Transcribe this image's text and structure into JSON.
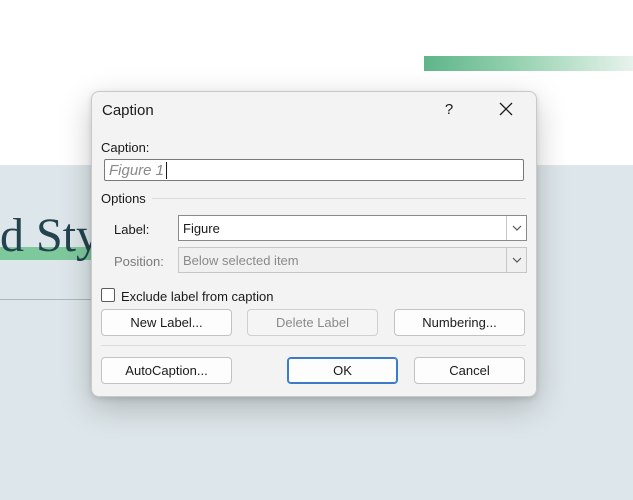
{
  "background": {
    "heading_text": "d Sty",
    "accent_color": "#5fb58a"
  },
  "dialog": {
    "title": "Caption",
    "help_glyph": "?",
    "close_glyph": "✕",
    "caption": {
      "label": "Caption:",
      "value": "Figure 1"
    },
    "options_label": "Options",
    "label_field": {
      "label": "Label:",
      "value": "Figure"
    },
    "position_field": {
      "label": "Position:",
      "value": "Below selected item",
      "disabled": true
    },
    "exclude_checkbox": {
      "label": "Exclude label from caption",
      "checked": false
    },
    "buttons": {
      "new_label": "New Label...",
      "delete_label": "Delete Label",
      "numbering": "Numbering...",
      "autocaption": "AutoCaption...",
      "ok": "OK",
      "cancel": "Cancel"
    },
    "focus_color": "#3b7bc8"
  }
}
